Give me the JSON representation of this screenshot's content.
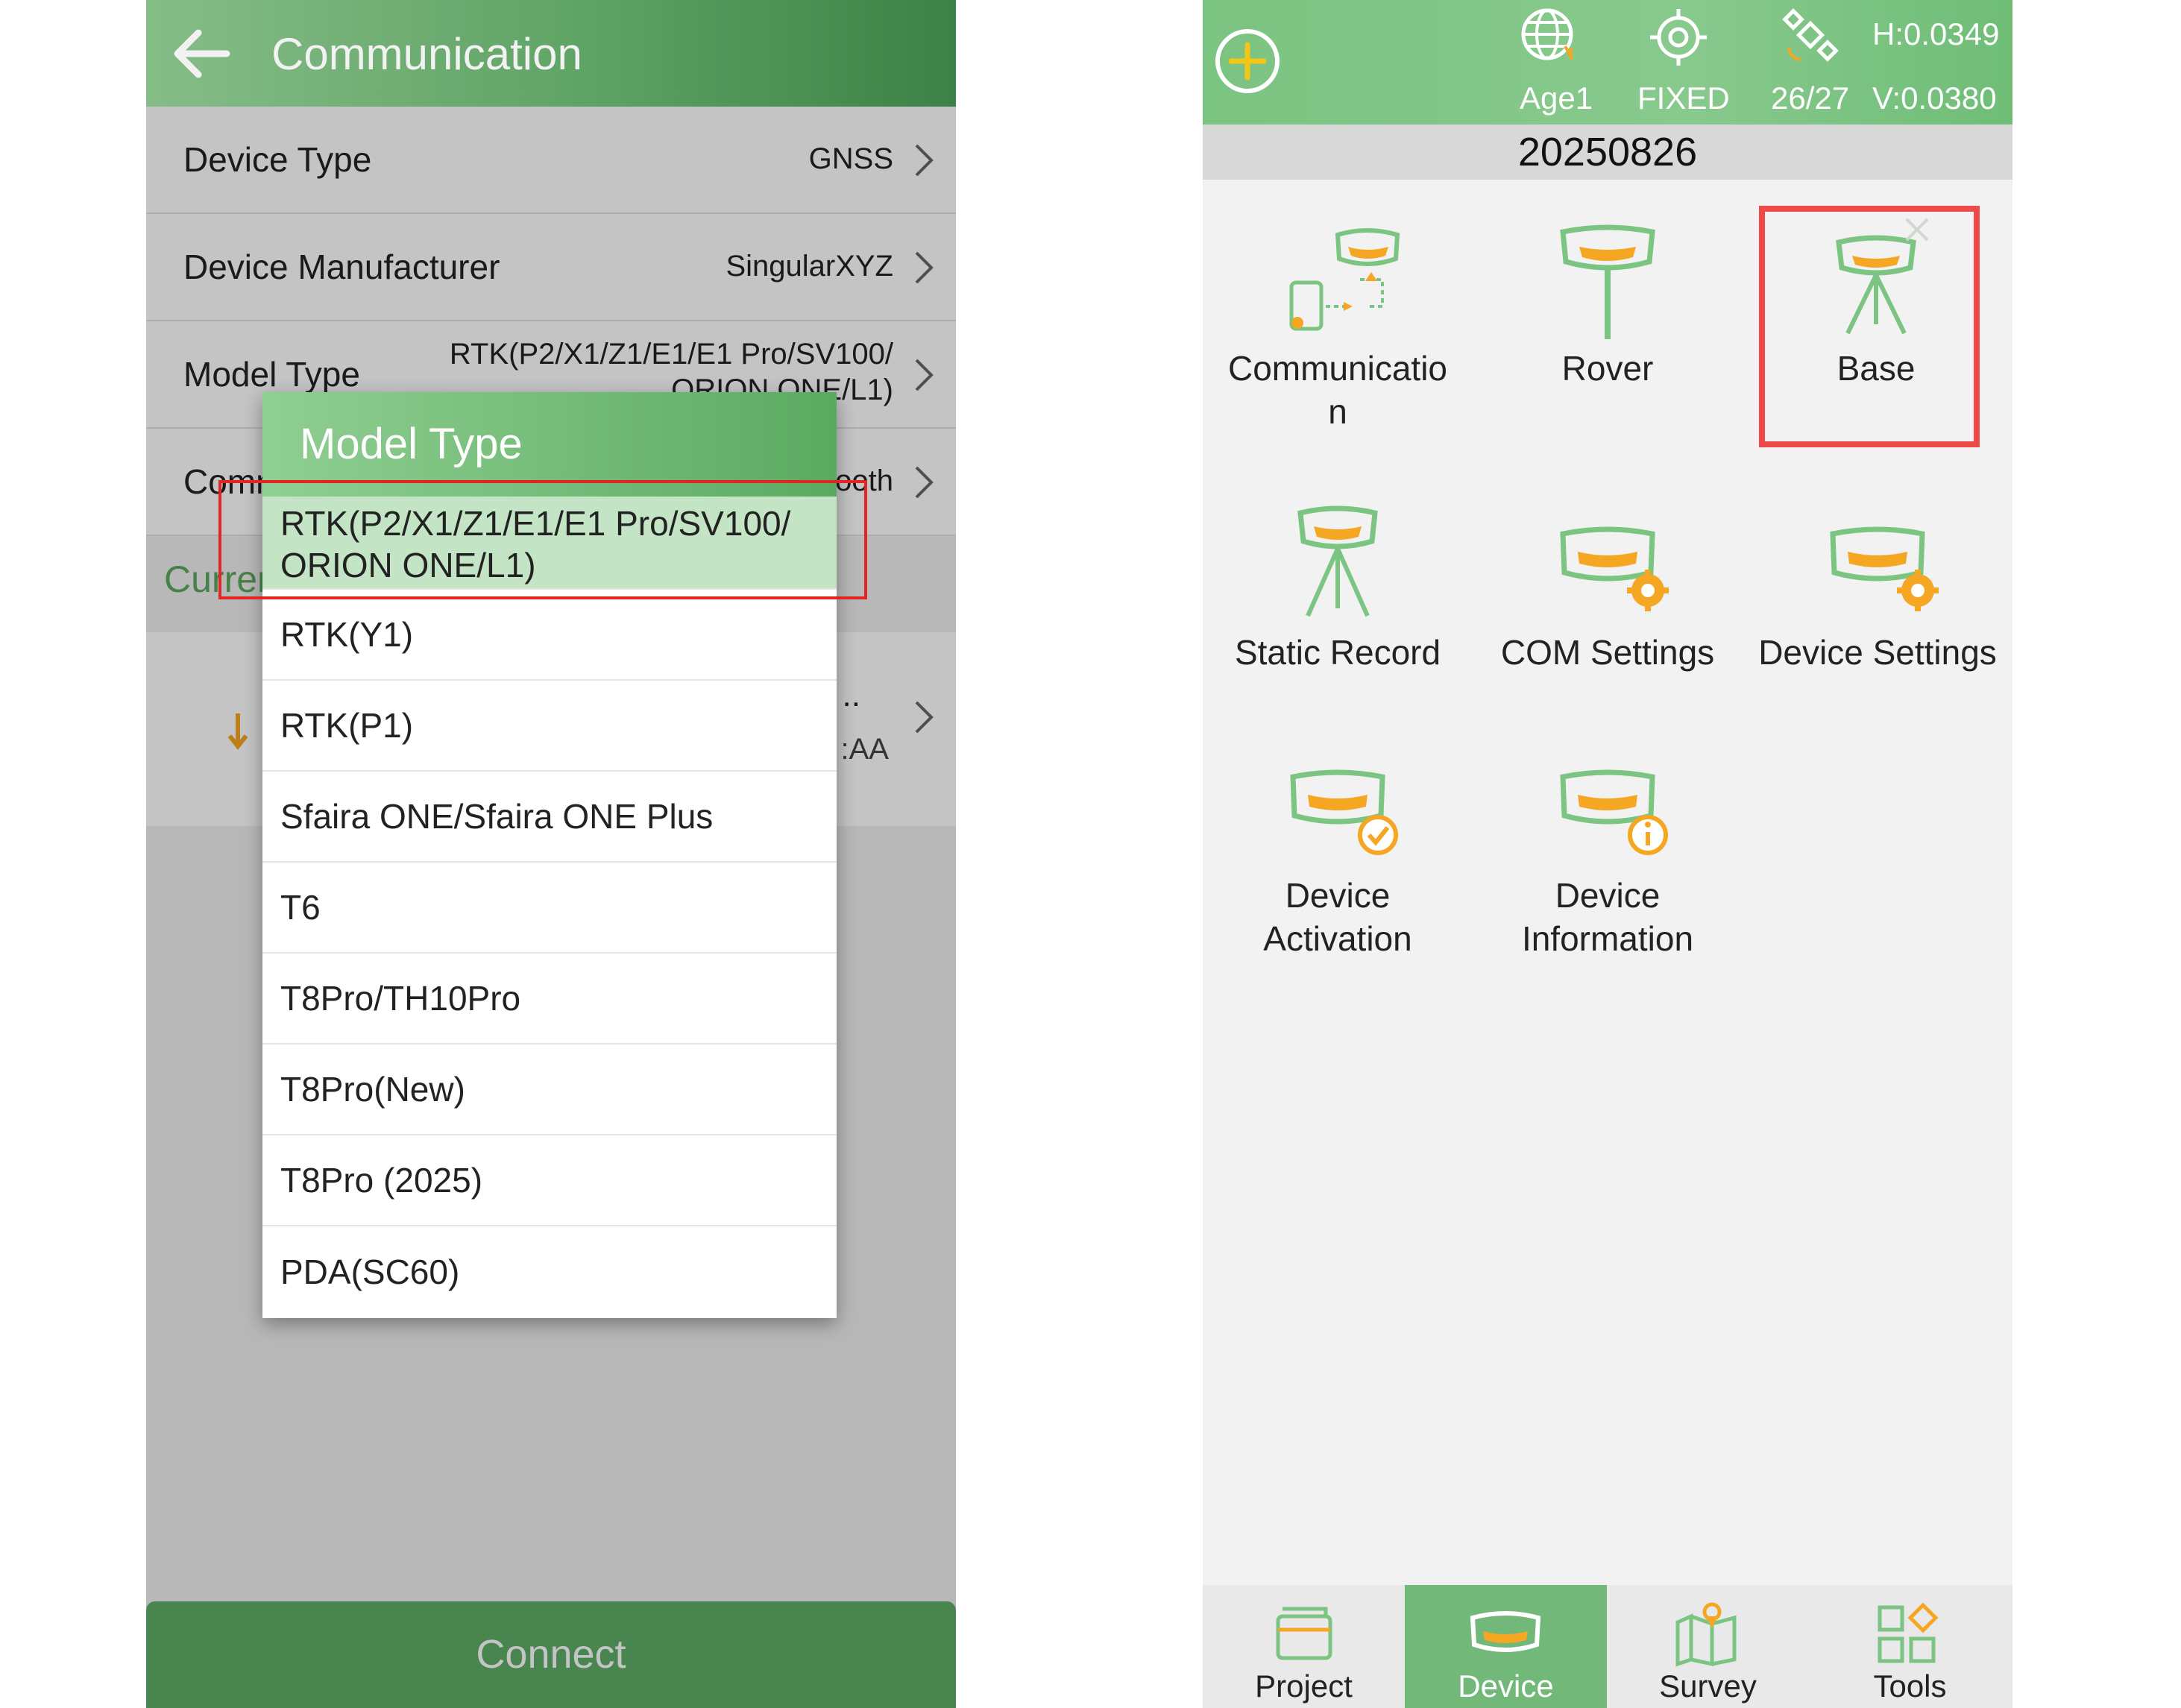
{
  "left": {
    "header": {
      "title": "Communication"
    },
    "rows": [
      {
        "label": "Device Type",
        "value": "GNSS"
      },
      {
        "label": "Device Manufacturer",
        "value": "SingularXYZ"
      },
      {
        "label": "Model Type",
        "value_line1": "RTK(P2/X1/Z1/E1/E1 Pro/SV100/",
        "value_line2": "ORION ONE/L1)"
      },
      {
        "label": "Comm",
        "value": "Bluetooth"
      }
    ],
    "current_label": "Current",
    "device": {
      "name": "..",
      "mac": ":AA"
    },
    "connect_label": "Connect",
    "dialog": {
      "title": "Model Type",
      "selected_line1": "RTK(P2/X1/Z1/E1/E1 Pro/SV100/",
      "selected_line2": "ORION ONE/L1)",
      "options": [
        "RTK(Y1)",
        "RTK(P1)",
        "Sfaira ONE/Sfaira ONE Plus",
        "T6",
        "T8Pro/TH10Pro",
        "T8Pro(New)",
        "T8Pro (2025)",
        "PDA(SC60)"
      ]
    }
  },
  "right": {
    "status": {
      "age": "Age1",
      "solution": "FIXED",
      "satellites": "26/27",
      "h_precision": "H:0.0349",
      "v_precision": "V:0.0380"
    },
    "project_name": "20250826",
    "tiles": [
      {
        "line1": "Communicatio",
        "line2": "n"
      },
      {
        "line1": "Rover",
        "line2": ""
      },
      {
        "line1": "Base",
        "line2": ""
      },
      {
        "line1": "Static Record",
        "line2": ""
      },
      {
        "line1": "COM Settings",
        "line2": ""
      },
      {
        "line1": "Device Settings",
        "line2": ""
      },
      {
        "line1": "Device",
        "line2": "Activation"
      },
      {
        "line1": "Device",
        "line2": "Information"
      }
    ],
    "tabs": [
      "Project",
      "Device",
      "Survey",
      "Tools"
    ],
    "active_tab": "Device"
  },
  "colors": {
    "brand_green": "#64ac6a",
    "accent_orange": "#f5a623",
    "highlight_red": "#ef4a4a"
  }
}
